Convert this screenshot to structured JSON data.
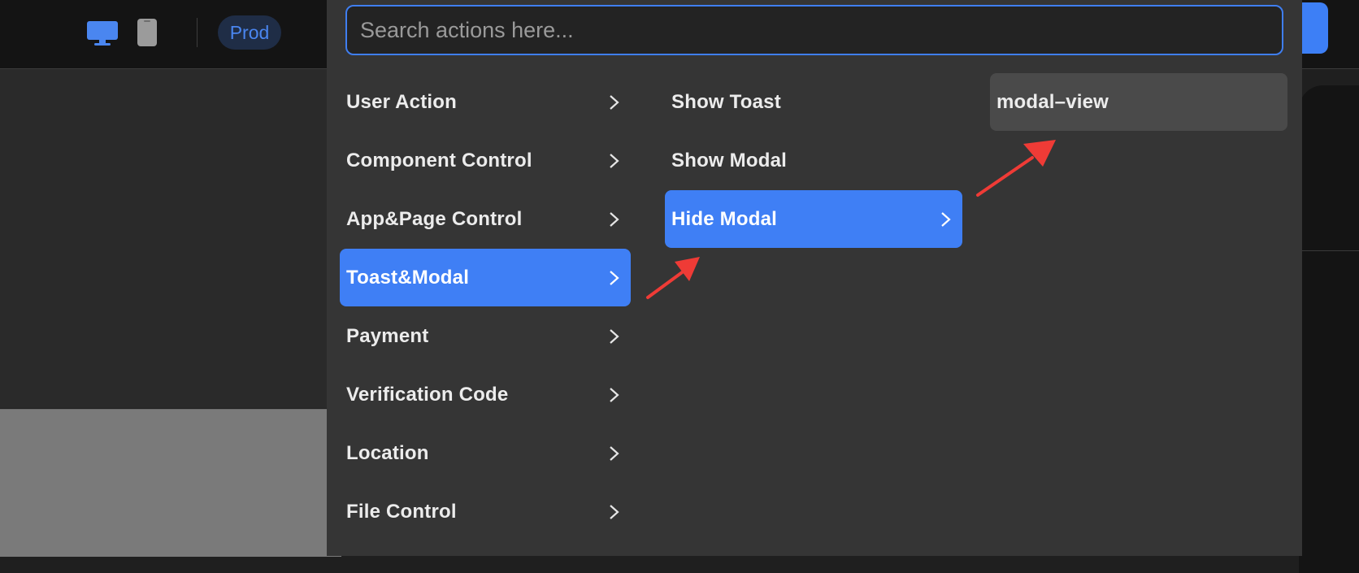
{
  "header": {
    "env_badge": "Prod",
    "icons": [
      "desktop-icon",
      "mobile-icon"
    ]
  },
  "picker": {
    "search_placeholder": "Search actions here...",
    "categories": [
      {
        "label": "User Action"
      },
      {
        "label": "Component Control"
      },
      {
        "label": "App&Page Control"
      },
      {
        "label": "Toast&Modal",
        "selected": true
      },
      {
        "label": "Payment"
      },
      {
        "label": "Verification Code"
      },
      {
        "label": "Location"
      },
      {
        "label": "File Control"
      }
    ],
    "actions": [
      {
        "label": "Show Toast"
      },
      {
        "label": "Show Modal"
      },
      {
        "label": "Hide Modal",
        "selected": true
      }
    ],
    "targets": [
      {
        "label": "modal–view",
        "hovered": true
      }
    ]
  },
  "colors": {
    "accent": "#3f7ff5",
    "annotation_arrow": "#ef3b36",
    "panel_bg": "#353535"
  }
}
